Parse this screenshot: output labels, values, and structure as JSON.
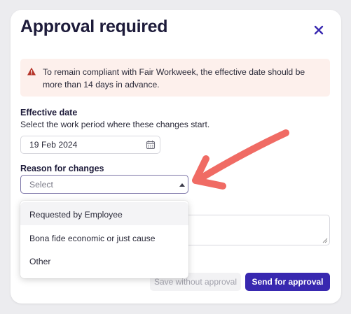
{
  "modal": {
    "title": "Approval required",
    "close_icon": "close-icon"
  },
  "alert": {
    "icon": "warning-icon",
    "message": "To remain compliant with Fair Workweek, the effective date should be more than 14 days in advance."
  },
  "effective_date": {
    "label": "Effective date",
    "help": "Select the work period where these changes start.",
    "value": "19 Feb 2024",
    "icon": "calendar-icon"
  },
  "reason": {
    "label": "Reason for changes",
    "placeholder": "Select",
    "options": [
      "Requested by Employee",
      "Bona fide economic or just cause",
      "Other"
    ]
  },
  "buttons": {
    "secondary": "Save without approval",
    "primary": "Send for approval"
  },
  "colors": {
    "primary": "#3828b0",
    "annotation_arrow": "#f06b64",
    "alert_bg": "#fdf0ec",
    "warning_icon": "#b5352a"
  }
}
